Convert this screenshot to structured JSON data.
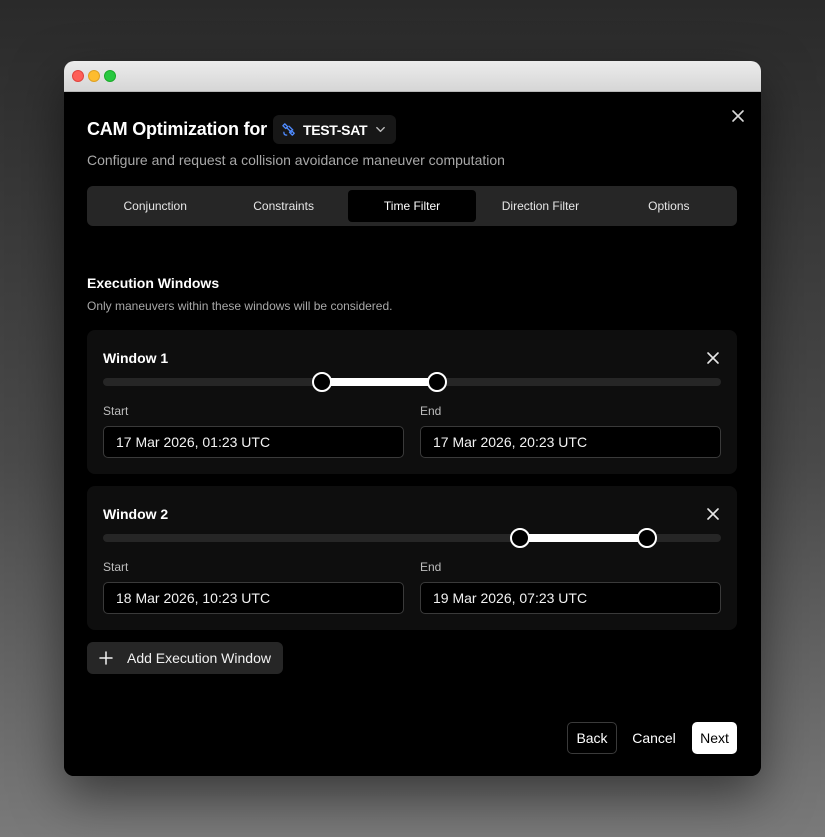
{
  "dialog": {
    "title": "CAM Optimization for",
    "satellite": "TEST-SAT",
    "subtitle": "Configure and request a collision avoidance maneuver computation"
  },
  "tabs": [
    {
      "label": "Conjunction",
      "active": false
    },
    {
      "label": "Constraints",
      "active": false
    },
    {
      "label": "Time Filter",
      "active": true
    },
    {
      "label": "Direction Filter",
      "active": false
    },
    {
      "label": "Options",
      "active": false
    }
  ],
  "section": {
    "title": "Execution Windows",
    "description": "Only maneuvers within these windows will be considered."
  },
  "windows": [
    {
      "title": "Window 1",
      "start_label": "Start",
      "end_label": "End",
      "start": "17 Mar 2026, 01:23 UTC",
      "end": "17 Mar 2026, 20:23 UTC",
      "range_start_pct": 35.5,
      "range_end_pct": 54
    },
    {
      "title": "Window 2",
      "start_label": "Start",
      "end_label": "End",
      "start": "18 Mar 2026, 10:23 UTC",
      "end": "19 Mar 2026, 07:23 UTC",
      "range_start_pct": 67.5,
      "range_end_pct": 88
    }
  ],
  "add_window_label": "Add Execution Window",
  "footer": {
    "back": "Back",
    "cancel": "Cancel",
    "next": "Next"
  },
  "icons": {
    "close": "close-icon",
    "satellite": "satellite-icon",
    "chevron": "chevron-down-icon",
    "plus": "plus-icon"
  },
  "colors": {
    "satellite_icon": "#4f8bff",
    "background": "#000000",
    "panel": "#262626"
  }
}
